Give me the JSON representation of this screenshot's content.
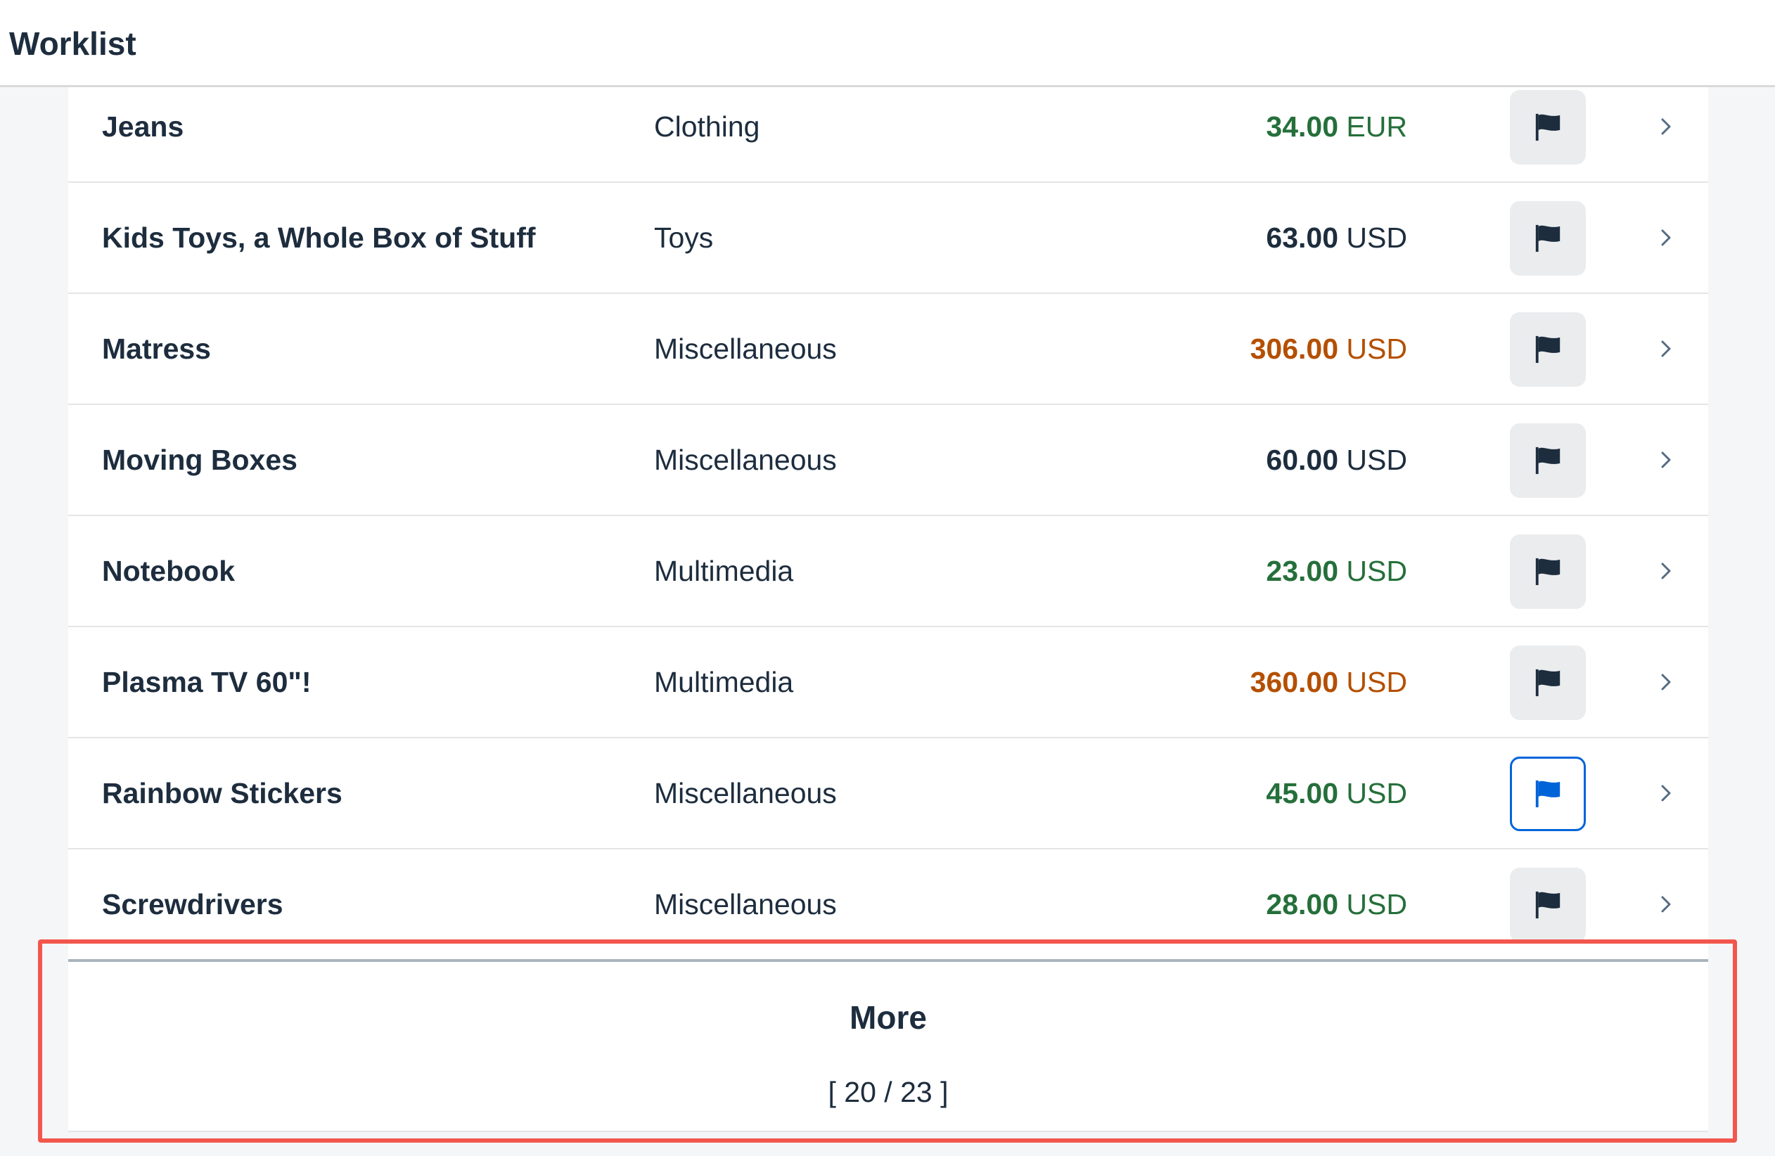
{
  "header": {
    "title": "Worklist"
  },
  "rows": [
    {
      "name": "Jeans",
      "category": "Clothing",
      "amount": "34.00",
      "currency": "EUR",
      "state": "good",
      "flag_focused": false
    },
    {
      "name": "Kids Toys, a Whole Box of Stuff",
      "category": "Toys",
      "amount": "63.00",
      "currency": "USD",
      "state": "neutral",
      "flag_focused": false
    },
    {
      "name": "Matress",
      "category": "Miscellaneous",
      "amount": "306.00",
      "currency": "USD",
      "state": "warn",
      "flag_focused": false
    },
    {
      "name": "Moving Boxes",
      "category": "Miscellaneous",
      "amount": "60.00",
      "currency": "USD",
      "state": "neutral",
      "flag_focused": false
    },
    {
      "name": "Notebook",
      "category": "Multimedia",
      "amount": "23.00",
      "currency": "USD",
      "state": "good",
      "flag_focused": false
    },
    {
      "name": "Plasma TV 60\"!",
      "category": "Multimedia",
      "amount": "360.00",
      "currency": "USD",
      "state": "warn",
      "flag_focused": false
    },
    {
      "name": "Rainbow Stickers",
      "category": "Miscellaneous",
      "amount": "45.00",
      "currency": "USD",
      "state": "good",
      "flag_focused": true
    },
    {
      "name": "Screwdrivers",
      "category": "Miscellaneous",
      "amount": "28.00",
      "currency": "USD",
      "state": "good",
      "flag_focused": false
    }
  ],
  "more": {
    "label": "More",
    "count": "[ 20 / 23 ]"
  },
  "colors": {
    "good": "#256f3a",
    "warn": "#b44f00",
    "neutral": "#1d2d3e",
    "flag_default": "#1d2d3e",
    "flag_focused": "#0064d9",
    "highlight": "#f2564d"
  },
  "icons": {
    "flag": "flag-icon",
    "chevron": "chevron-right-icon"
  }
}
